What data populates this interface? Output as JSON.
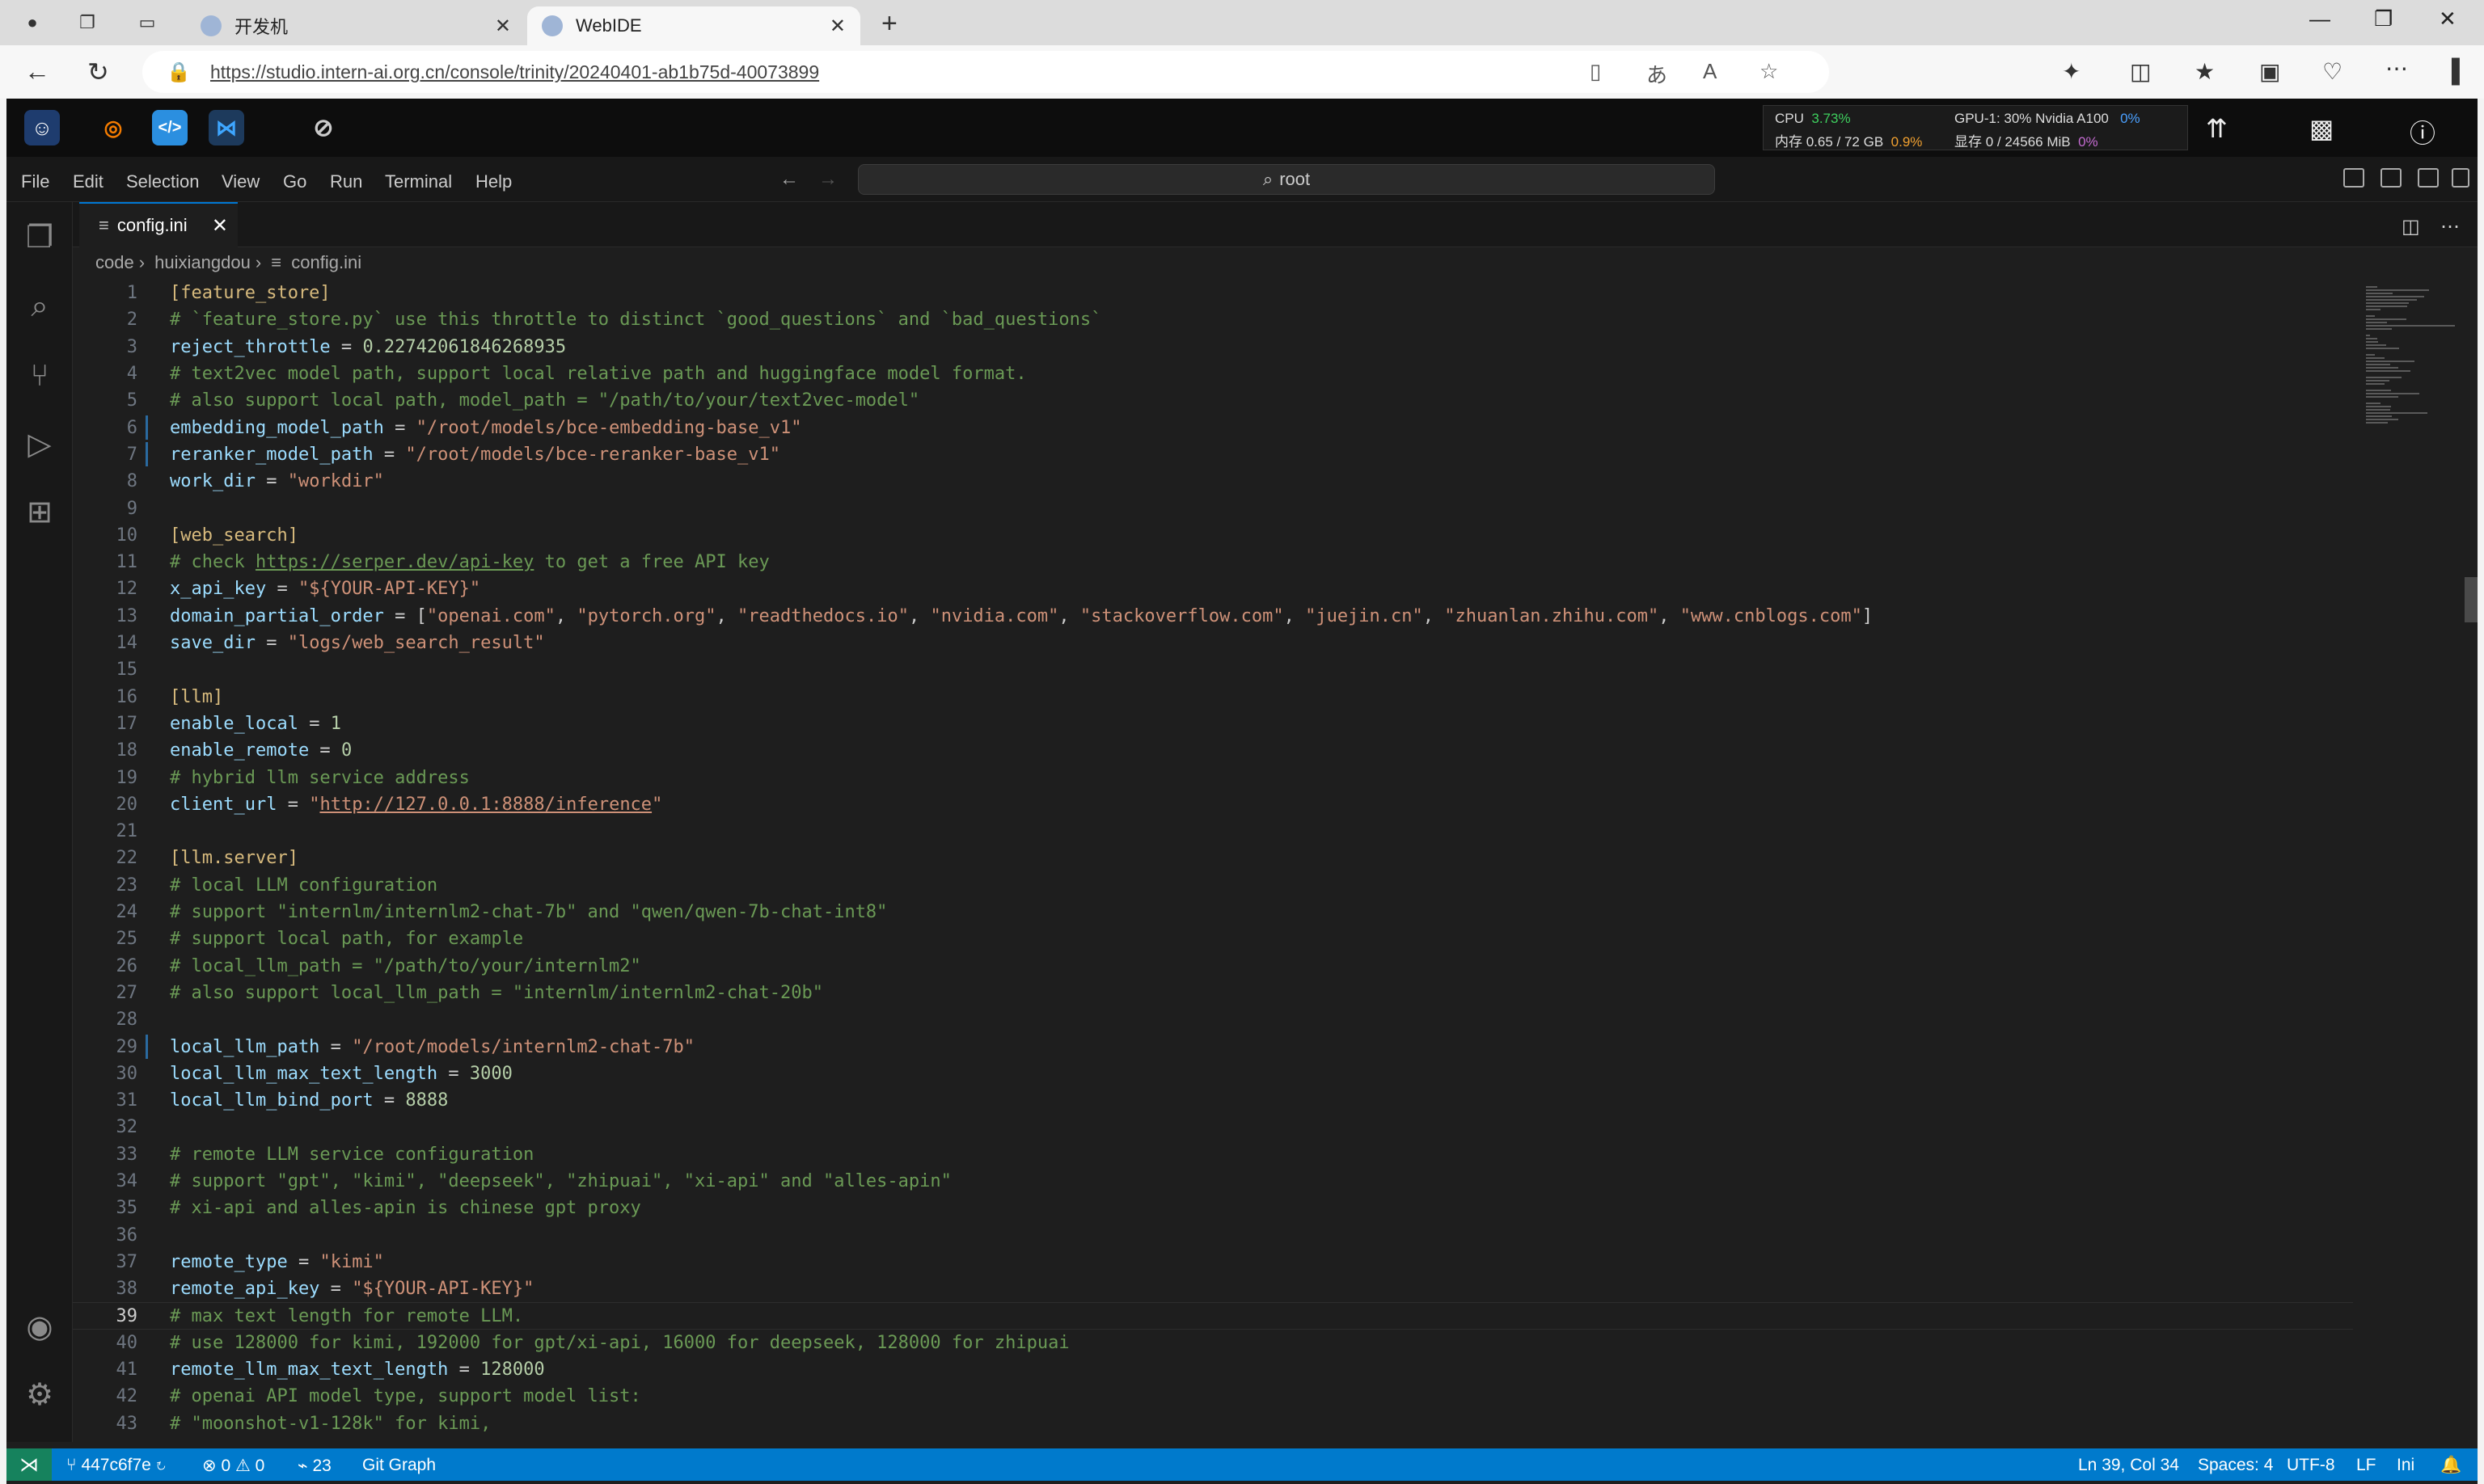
{
  "browser": {
    "tabs": [
      {
        "title": "开发机",
        "active": false
      },
      {
        "title": "WebIDE",
        "active": true
      }
    ],
    "url": "https://studio.intern-ai.org.cn/console/trinity/20240401-ab1b75d-40073899"
  },
  "metrics": {
    "cpu_label": "CPU",
    "cpu_value": "3.73%",
    "mem_label": "内存 0.65 / 72 GB",
    "mem_value": "0.9%",
    "gpu_label": "GPU-1: 30% Nvidia A100",
    "gpu_value": "0%",
    "vram_label": "显存 0 / 24566 MiB",
    "vram_value": "0%"
  },
  "menubar": {
    "items": [
      "File",
      "Edit",
      "Selection",
      "View",
      "Go",
      "Run",
      "Terminal",
      "Help"
    ],
    "command_center": "root"
  },
  "editor": {
    "tab": "config.ini",
    "breadcrumb": [
      "code",
      "huixiangdou",
      "config.ini"
    ],
    "current_line": 39,
    "modified_lines": [
      6,
      7,
      29
    ],
    "lines": [
      [
        [
          "sec",
          "[feature_store]"
        ]
      ],
      [
        [
          "c",
          "# `feature_store.py` use this throttle to distinct `good_questions` and `bad_questions`"
        ]
      ],
      [
        [
          "k",
          "reject_throttle"
        ],
        [
          "w",
          " = "
        ],
        [
          "n",
          "0.22742061846268935"
        ]
      ],
      [
        [
          "c",
          "# text2vec model path, support local relative path and huggingface model format."
        ]
      ],
      [
        [
          "c",
          "# also support local path, model_path = \"/path/to/your/text2vec-model\""
        ]
      ],
      [
        [
          "k",
          "embedding_model_path"
        ],
        [
          "w",
          " = "
        ],
        [
          "s",
          "\"/root/models/bce-embedding-base_v1\""
        ]
      ],
      [
        [
          "k",
          "reranker_model_path"
        ],
        [
          "w",
          " = "
        ],
        [
          "s",
          "\"/root/models/bce-reranker-base_v1\""
        ]
      ],
      [
        [
          "k",
          "work_dir"
        ],
        [
          "w",
          " = "
        ],
        [
          "s",
          "\"workdir\""
        ]
      ],
      [],
      [
        [
          "sec",
          "[web_search]"
        ]
      ],
      [
        [
          "c",
          "# check "
        ],
        [
          "url",
          "https://serper.dev/api-key"
        ],
        [
          "c",
          " to get a free API key"
        ]
      ],
      [
        [
          "k",
          "x_api_key"
        ],
        [
          "w",
          " = "
        ],
        [
          "s",
          "\"${YOUR-API-KEY}\""
        ]
      ],
      [
        [
          "k",
          "domain_partial_order"
        ],
        [
          "w",
          " = ["
        ],
        [
          "s",
          "\"openai.com\""
        ],
        [
          "w",
          ", "
        ],
        [
          "s",
          "\"pytorch.org\""
        ],
        [
          "w",
          ", "
        ],
        [
          "s",
          "\"readthedocs.io\""
        ],
        [
          "w",
          ", "
        ],
        [
          "s",
          "\"nvidia.com\""
        ],
        [
          "w",
          ", "
        ],
        [
          "s",
          "\"stackoverflow.com\""
        ],
        [
          "w",
          ", "
        ],
        [
          "s",
          "\"juejin.cn\""
        ],
        [
          "w",
          ", "
        ],
        [
          "s",
          "\"zhuanlan.zhihu.com\""
        ],
        [
          "w",
          ", "
        ],
        [
          "s",
          "\"www.cnblogs.com\""
        ],
        [
          "w",
          "]"
        ]
      ],
      [
        [
          "k",
          "save_dir"
        ],
        [
          "w",
          " = "
        ],
        [
          "s",
          "\"logs/web_search_result\""
        ]
      ],
      [],
      [
        [
          "sec",
          "[llm]"
        ]
      ],
      [
        [
          "k",
          "enable_local"
        ],
        [
          "w",
          " = "
        ],
        [
          "n",
          "1"
        ]
      ],
      [
        [
          "k",
          "enable_remote"
        ],
        [
          "w",
          " = "
        ],
        [
          "n",
          "0"
        ]
      ],
      [
        [
          "c",
          "# hybrid llm service address"
        ]
      ],
      [
        [
          "k",
          "client_url"
        ],
        [
          "w",
          " = "
        ],
        [
          "s",
          "\""
        ],
        [
          "surl",
          "http://127.0.0.1:8888/inference"
        ],
        [
          "s",
          "\""
        ]
      ],
      [],
      [
        [
          "sec",
          "[llm.server]"
        ]
      ],
      [
        [
          "c",
          "# local LLM configuration"
        ]
      ],
      [
        [
          "c",
          "# support \"internlm/internlm2-chat-7b\" and \"qwen/qwen-7b-chat-int8\""
        ]
      ],
      [
        [
          "c",
          "# support local path, for example"
        ]
      ],
      [
        [
          "c",
          "# local_llm_path = \"/path/to/your/internlm2\""
        ]
      ],
      [
        [
          "c",
          "# also support local_llm_path = \"internlm/internlm2-chat-20b\""
        ]
      ],
      [],
      [
        [
          "k",
          "local_llm_path"
        ],
        [
          "w",
          " = "
        ],
        [
          "s",
          "\"/root/models/internlm2-chat-7b\""
        ]
      ],
      [
        [
          "k",
          "local_llm_max_text_length"
        ],
        [
          "w",
          " = "
        ],
        [
          "n",
          "3000"
        ]
      ],
      [
        [
          "k",
          "local_llm_bind_port"
        ],
        [
          "w",
          " = "
        ],
        [
          "n",
          "8888"
        ]
      ],
      [],
      [
        [
          "c",
          "# remote LLM service configuration"
        ]
      ],
      [
        [
          "c",
          "# support \"gpt\", \"kimi\", \"deepseek\", \"zhipuai\", \"xi-api\" and \"alles-apin\""
        ]
      ],
      [
        [
          "c",
          "# xi-api and alles-apin is chinese gpt proxy"
        ]
      ],
      [],
      [
        [
          "k",
          "remote_type"
        ],
        [
          "w",
          " = "
        ],
        [
          "s",
          "\"kimi\""
        ]
      ],
      [
        [
          "k",
          "remote_api_key"
        ],
        [
          "w",
          " = "
        ],
        [
          "s",
          "\"${YOUR-API-KEY}\""
        ]
      ],
      [
        [
          "c",
          "# max text length for remote LLM."
        ]
      ],
      [
        [
          "c",
          "# use 128000 for kimi, 192000 for gpt/xi-api, 16000 for deepseek, 128000 for zhipuai"
        ]
      ],
      [
        [
          "k",
          "remote_llm_max_text_length"
        ],
        [
          "w",
          " = "
        ],
        [
          "n",
          "128000"
        ]
      ],
      [
        [
          "c",
          "# openai API model type, support model list:"
        ]
      ],
      [
        [
          "c",
          "# \"moonshot-v1-128k\" for kimi,"
        ]
      ]
    ]
  },
  "status": {
    "branch": "447c6f7e",
    "errors": "0",
    "warnings": "0",
    "ports": "23",
    "git_graph": "Git Graph",
    "position": "Ln 39, Col 34",
    "spaces": "Spaces: 4",
    "encoding": "UTF-8",
    "eol": "LF",
    "language": "Ini"
  },
  "colors": {
    "accent": "#007acc",
    "remote": "#16825d",
    "editor_bg": "#1e1e1e"
  },
  "icons": [
    "profile-icon",
    "workspaces-icon",
    "tab-actions-icon",
    "back-icon",
    "refresh-icon",
    "lock-icon",
    "explorer-icon",
    "search-icon",
    "source-control-icon",
    "run-debug-icon",
    "extensions-icon",
    "account-icon",
    "settings-icon"
  ]
}
